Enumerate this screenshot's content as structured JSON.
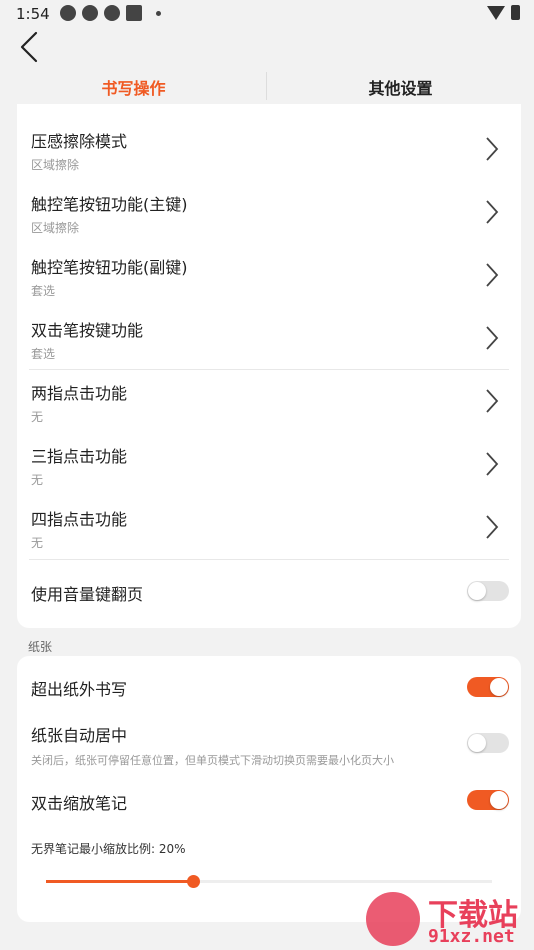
{
  "status_bar": {
    "time": "1:54"
  },
  "tabs": [
    {
      "label": "书写操作",
      "active": true
    },
    {
      "label": "其他设置",
      "active": false
    }
  ],
  "writing_settings": [
    {
      "title": "压感擦除模式",
      "value": "区域擦除"
    },
    {
      "title": "触控笔按钮功能(主键)",
      "value": "区域擦除"
    },
    {
      "title": "触控笔按钮功能(副键)",
      "value": "套选"
    },
    {
      "title": "双击笔按键功能",
      "value": "套选"
    },
    {
      "title": "两指点击功能",
      "value": "无"
    },
    {
      "title": "三指点击功能",
      "value": "无"
    },
    {
      "title": "四指点击功能",
      "value": "无"
    }
  ],
  "volume_flip": {
    "title": "使用音量键翻页",
    "enabled": false
  },
  "paper_section": {
    "label": "纸张",
    "write_outside": {
      "title": "超出纸外书写",
      "enabled": true
    },
    "auto_center": {
      "title": "纸张自动居中",
      "description": "关闭后，纸张可停留任意位置，但单页模式下滑动切换页需要最小化页大小",
      "enabled": false
    },
    "double_tap_zoom": {
      "title": "双击缩放笔记",
      "enabled": true
    },
    "min_zoom": {
      "label": "无界笔记最小缩放比例: 20%",
      "fraction": 0.33
    }
  },
  "watermark": {
    "text": "下载站",
    "url": "91xz.net"
  },
  "colors": {
    "accent": "#f05a23",
    "background": "#f2f2f2",
    "card": "#ffffff",
    "watermark": "#e8405b"
  }
}
